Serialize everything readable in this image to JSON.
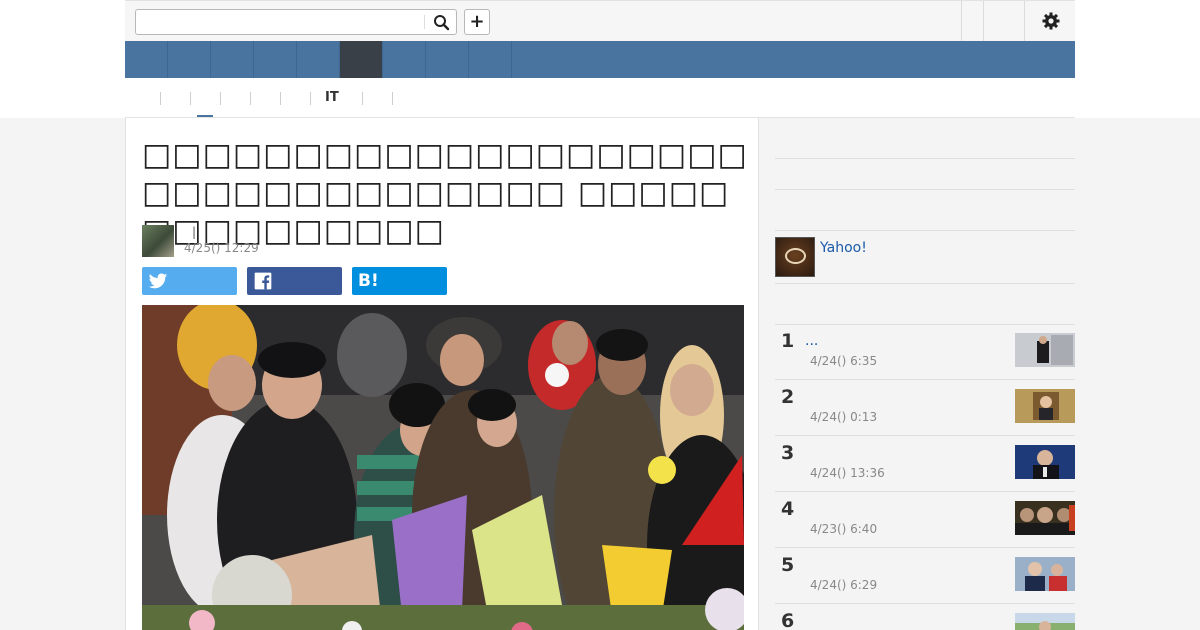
{
  "search": {
    "placeholder": "",
    "value": ""
  },
  "toolbar": {
    "add_label": "+"
  },
  "subnav": {
    "it_label": "IT"
  },
  "article": {
    "headline": "□□□□□□□□□□□□□□□□□□□□□□□□□□□□□□□□□□ □□□□□ □□□□□□□□□□",
    "author_separator": "|",
    "published": "4/25() 12:29"
  },
  "share": {
    "hatena_label": "B!"
  },
  "sidebar": {
    "yahoo_label": "Yahoo!",
    "ranking": [
      {
        "rank": "1",
        "title": "...",
        "date": "4/24() 6:35"
      },
      {
        "rank": "2",
        "title": "",
        "date": "4/24() 0:13"
      },
      {
        "rank": "3",
        "title": "",
        "date": "4/24() 13:36"
      },
      {
        "rank": "4",
        "title": "",
        "date": "4/23() 6:40"
      },
      {
        "rank": "5",
        "title": "",
        "date": "4/24() 6:29"
      },
      {
        "rank": "6",
        "title": "",
        "date": ""
      }
    ]
  },
  "colors": {
    "nav_blue": "#4a74a0",
    "nav_active": "#3a4048",
    "twitter": "#55acee",
    "facebook": "#3b5998",
    "hatena": "#008fde",
    "link": "#1a5aa8"
  }
}
